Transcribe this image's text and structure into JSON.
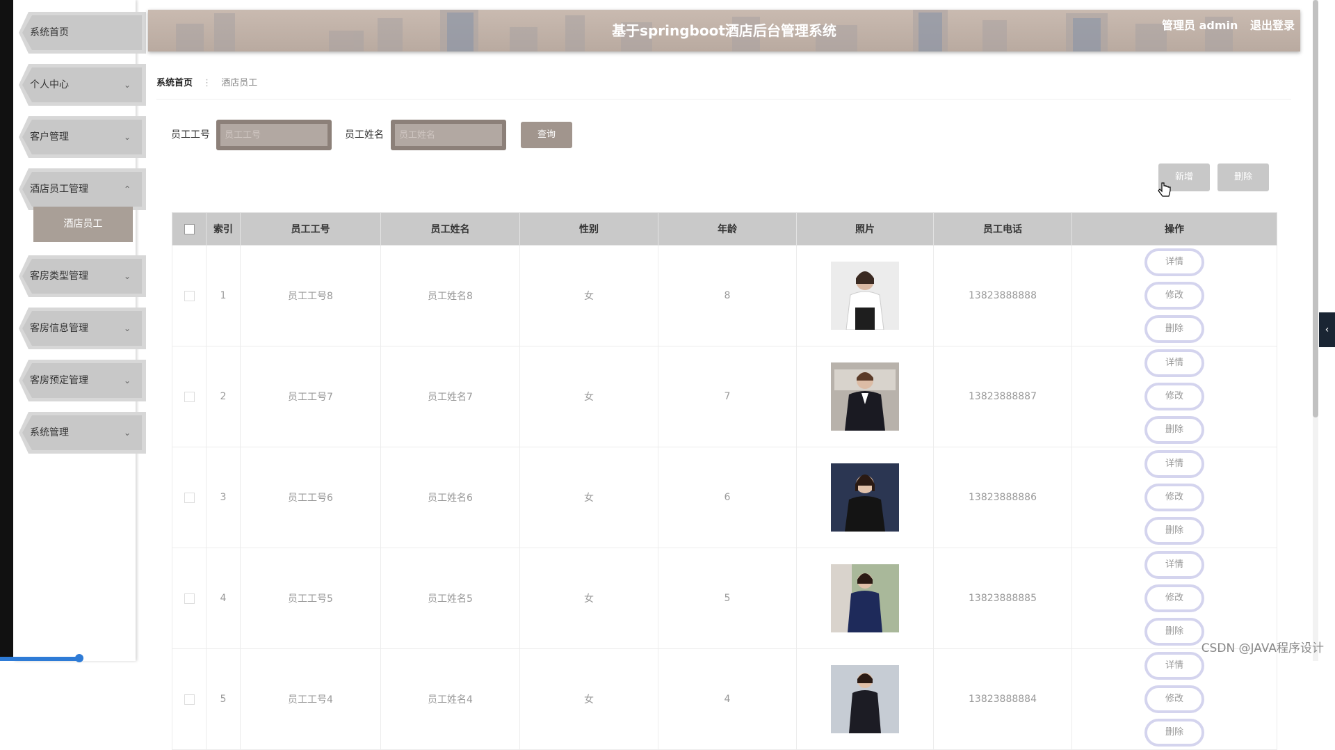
{
  "header": {
    "title": "基于springboot酒店后台管理系统",
    "user_label": "管理员 admin",
    "logout_label": "退出登录"
  },
  "sidebar": {
    "items": [
      {
        "label": "系统首页",
        "has_chevron": false
      },
      {
        "label": "个人中心",
        "has_chevron": true
      },
      {
        "label": "客户管理",
        "has_chevron": true
      },
      {
        "label": "酒店员工管理",
        "has_chevron": true,
        "expanded": true
      },
      {
        "label": "客房类型管理",
        "has_chevron": true
      },
      {
        "label": "客房信息管理",
        "has_chevron": true
      },
      {
        "label": "客房预定管理",
        "has_chevron": true
      },
      {
        "label": "系统管理",
        "has_chevron": true
      }
    ],
    "sub_item": "酒店员工",
    "chevron_down": "⌄",
    "chevron_up": "⌃"
  },
  "breadcrumb": {
    "home": "系统首页",
    "separator": "⋮",
    "current": "酒店员工"
  },
  "search": {
    "field1_label": "员工工号",
    "field1_placeholder": "员工工号",
    "field2_label": "员工姓名",
    "field2_placeholder": "员工姓名",
    "query_label": "查询"
  },
  "actions": {
    "add_label": "新增",
    "delete_label": "删除"
  },
  "table": {
    "columns": [
      "",
      "索引",
      "员工工号",
      "员工姓名",
      "性别",
      "年龄",
      "照片",
      "员工电话",
      "操作"
    ],
    "rows": [
      {
        "index": "1",
        "id": "员工工号8",
        "name": "员工姓名8",
        "gender": "女",
        "age": "8",
        "phone": "13823888888"
      },
      {
        "index": "2",
        "id": "员工工号7",
        "name": "员工姓名7",
        "gender": "女",
        "age": "7",
        "phone": "13823888887"
      },
      {
        "index": "3",
        "id": "员工工号6",
        "name": "员工姓名6",
        "gender": "女",
        "age": "6",
        "phone": "13823888886"
      },
      {
        "index": "4",
        "id": "员工工号5",
        "name": "员工姓名5",
        "gender": "女",
        "age": "5",
        "phone": "13823888885"
      },
      {
        "index": "5",
        "id": "员工工号4",
        "name": "员工姓名4",
        "gender": "女",
        "age": "4",
        "phone": "13823888884"
      }
    ],
    "op_detail": "详情",
    "op_edit": "修改",
    "op_delete": "删除"
  },
  "watermark": "CSDN @JAVA程序设计",
  "collapse_tab_icon": "‹",
  "colors": {
    "header_bg": "#c0b1a7",
    "sidebar_item": "#c8c8c8",
    "sidebar_active": "#a99f97",
    "table_header": "#c9c9c9",
    "op_border": "#d4d4ee"
  }
}
